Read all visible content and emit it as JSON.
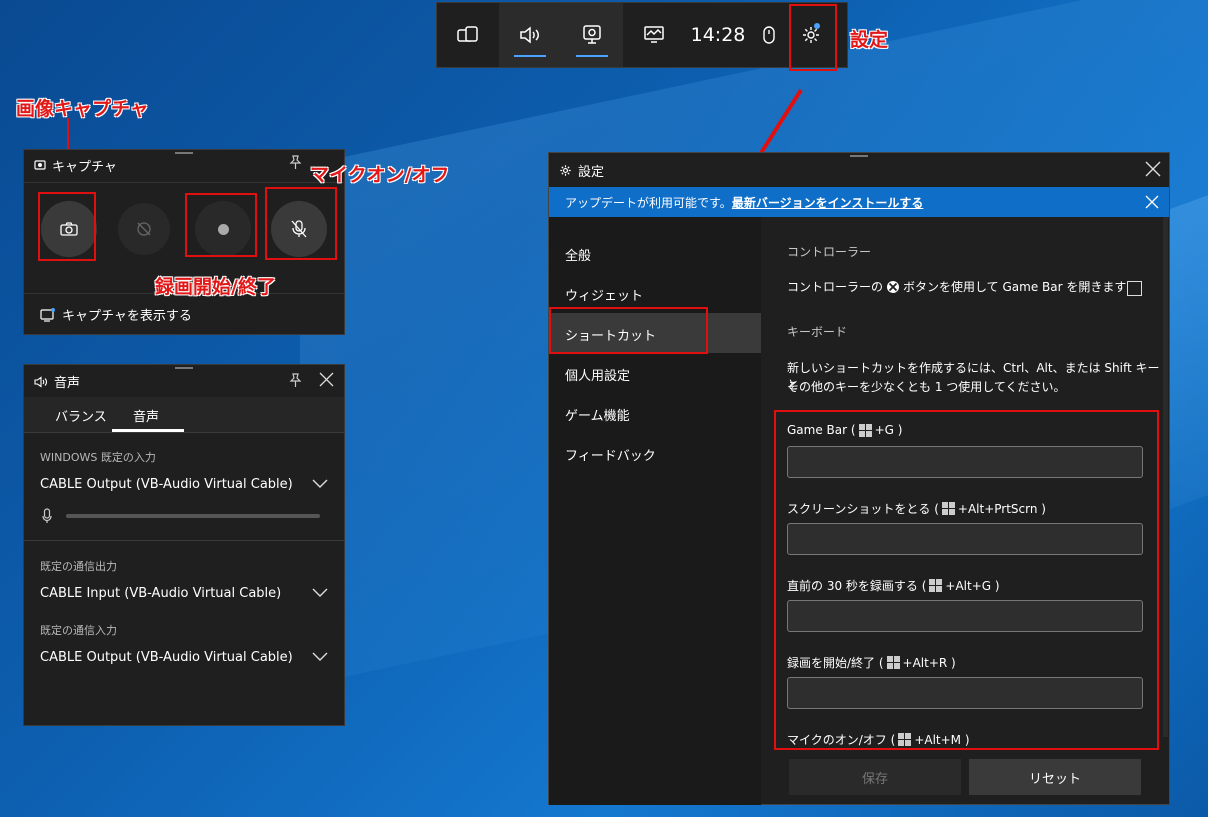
{
  "topbar": {
    "time": "14:28"
  },
  "annotations": {
    "settings": "設定",
    "capture_image": "画像キャプチャ",
    "mic": "マイクオン/オフ",
    "record": "録画開始/終了"
  },
  "capture": {
    "title": "キャプチャ",
    "show_captures": "キャプチャを表示する"
  },
  "audio": {
    "title": "音声",
    "tabs": [
      "バランス",
      "音声"
    ],
    "input_section": "WINDOWS 既定の入力",
    "input_device": "CABLE Output (VB-Audio Virtual Cable)",
    "comm_out_label": "既定の通信出力",
    "comm_out_device": "CABLE Input (VB-Audio Virtual Cable)",
    "comm_in_label": "既定の通信入力",
    "comm_in_device": "CABLE Output (VB-Audio Virtual Cable)"
  },
  "settings": {
    "title": "設定",
    "banner_text": "アップデートが利用可能です。",
    "banner_link": "最新バージョンをインストールする",
    "nav": [
      "全般",
      "ウィジェット",
      "ショートカット",
      "個人用設定",
      "ゲーム機能",
      "フィードバック"
    ],
    "controller_section": "コントローラー",
    "controller_text_a": "コントローラーの",
    "controller_text_b": "ボタンを使用して Game Bar を開きます",
    "keyboard_section": "キーボード",
    "keyboard_desc_1": "新しいショートカットを作成するには、Ctrl、Alt、または Shift キーと",
    "keyboard_desc_2": "その他のキーを少なくとも 1 つ使用してください。",
    "shortcuts": [
      {
        "label": "Game Bar (",
        "keys": "+G )"
      },
      {
        "label": "スクリーンショットをとる (",
        "keys": "+Alt+PrtScrn )"
      },
      {
        "label": "直前の 30 秒を録画する (",
        "keys": "+Alt+G )"
      },
      {
        "label": "録画を開始/終了 (",
        "keys": "+Alt+R )"
      },
      {
        "label": "マイクのオン/オフ (",
        "keys": "+Alt+M )"
      }
    ],
    "save": "保存",
    "reset": "リセット"
  }
}
